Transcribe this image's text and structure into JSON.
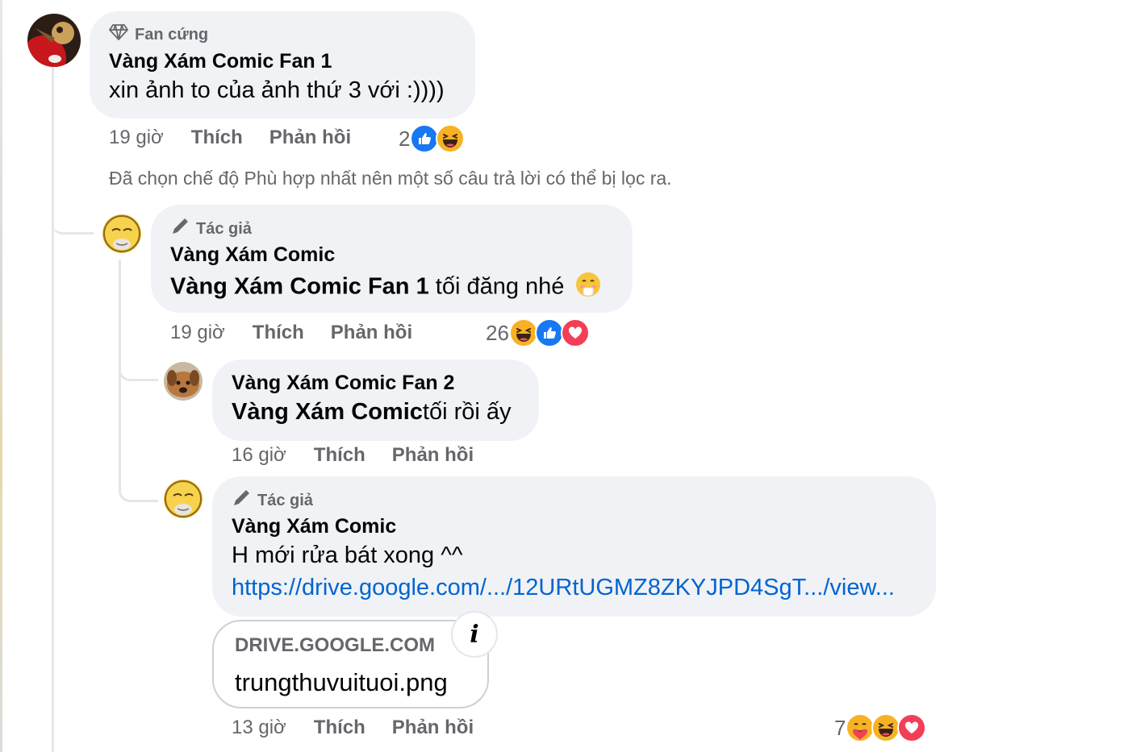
{
  "comments": [
    {
      "badge": "Fan cứng",
      "author": "Vàng Xám Comic Fan 1",
      "text": "xin ảnh to của ảnh thứ 3 với :))))",
      "time": "19 giờ",
      "like_label": "Thích",
      "reply_label": "Phản hồi",
      "reaction_count": "2",
      "reactions": [
        "like",
        "haha"
      ]
    },
    {
      "badge": "Tác giả",
      "author": "Vàng Xám Comic",
      "mention": "Vàng Xám Comic Fan 1",
      "text": " tối đăng nhé",
      "emoji": "blushing-face",
      "time": "19 giờ",
      "like_label": "Thích",
      "reply_label": "Phản hồi",
      "reaction_count": "26",
      "reactions": [
        "haha",
        "like",
        "love"
      ]
    },
    {
      "author": "Vàng Xám Comic Fan 2",
      "mention": "Vàng Xám Comic",
      "text": "tối rồi ấy",
      "time": "16 giờ",
      "like_label": "Thích",
      "reply_label": "Phản hồi"
    },
    {
      "badge": "Tác giả",
      "author": "Vàng Xám Comic",
      "text": "H mới rửa bát xong ^^",
      "link": "https://drive.google.com/.../12URtUGMZ8ZKYJPD4SgT.../view...",
      "preview_domain": "DRIVE.GOOGLE.COM",
      "preview_title": "trungthuvuituoi.png",
      "time": "13 giờ",
      "like_label": "Thích",
      "reply_label": "Phản hồi",
      "reaction_count": "7",
      "reactions": [
        "care",
        "haha",
        "love"
      ]
    }
  ],
  "filter_note": "Đã chọn chế độ Phù hợp nhất nên một số câu trả lời có thể bị lọc ra.",
  "colors": {
    "bubble": "#f0f2f5",
    "meta": "#65676b",
    "link": "#0064d1",
    "like": "#1877f2",
    "love": "#f33e58",
    "haha": "#f7b125"
  }
}
